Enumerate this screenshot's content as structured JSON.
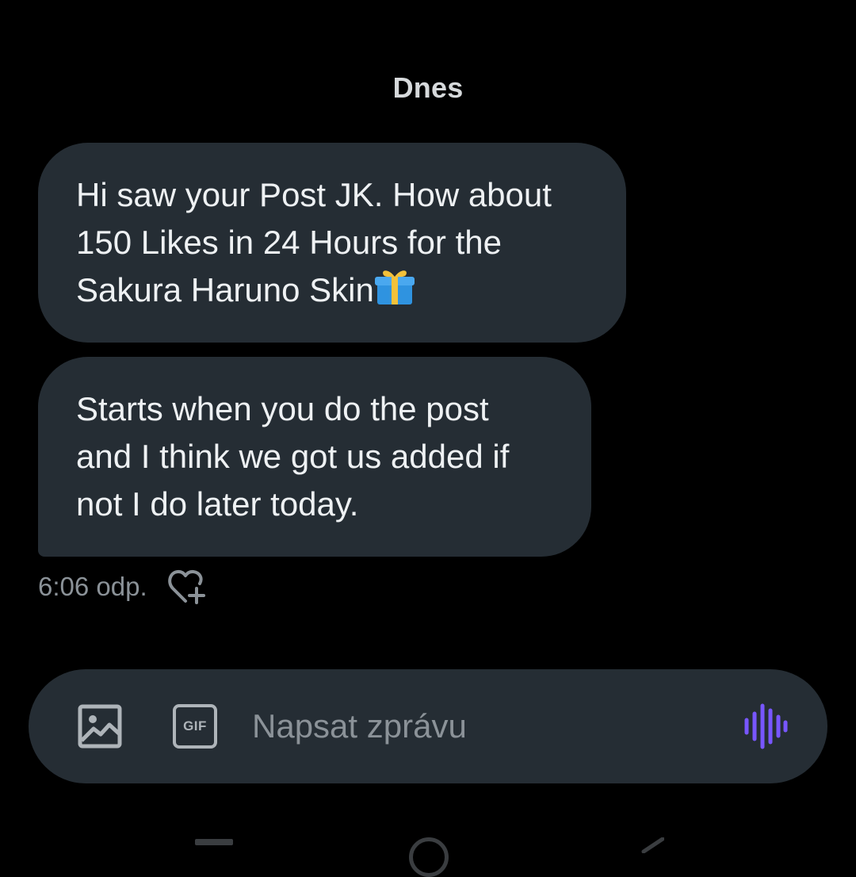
{
  "conversation": {
    "date_divider": "Dnes",
    "messages": [
      {
        "lines": [
          "Hi saw your Post JK. How about",
          "150 Likes in 24 Hours for the",
          "Sakura Haruno Skin"
        ],
        "trailing_icon": "gift-emoji-icon"
      },
      {
        "lines": [
          "Starts when you do the post",
          "and I think we got us added if",
          "not I do later today."
        ]
      }
    ],
    "timestamp": "6:06 odp.",
    "reaction_icon": "heart-plus-icon"
  },
  "composer": {
    "image_icon": "image-icon",
    "gif_label": "GIF",
    "placeholder": "Napsat zprávu",
    "voice_icon": "voice-waveform-icon",
    "voice_color": "#7856ff"
  },
  "navbar": {
    "icons": [
      "recents-icon",
      "home-icon",
      "back-icon"
    ]
  }
}
